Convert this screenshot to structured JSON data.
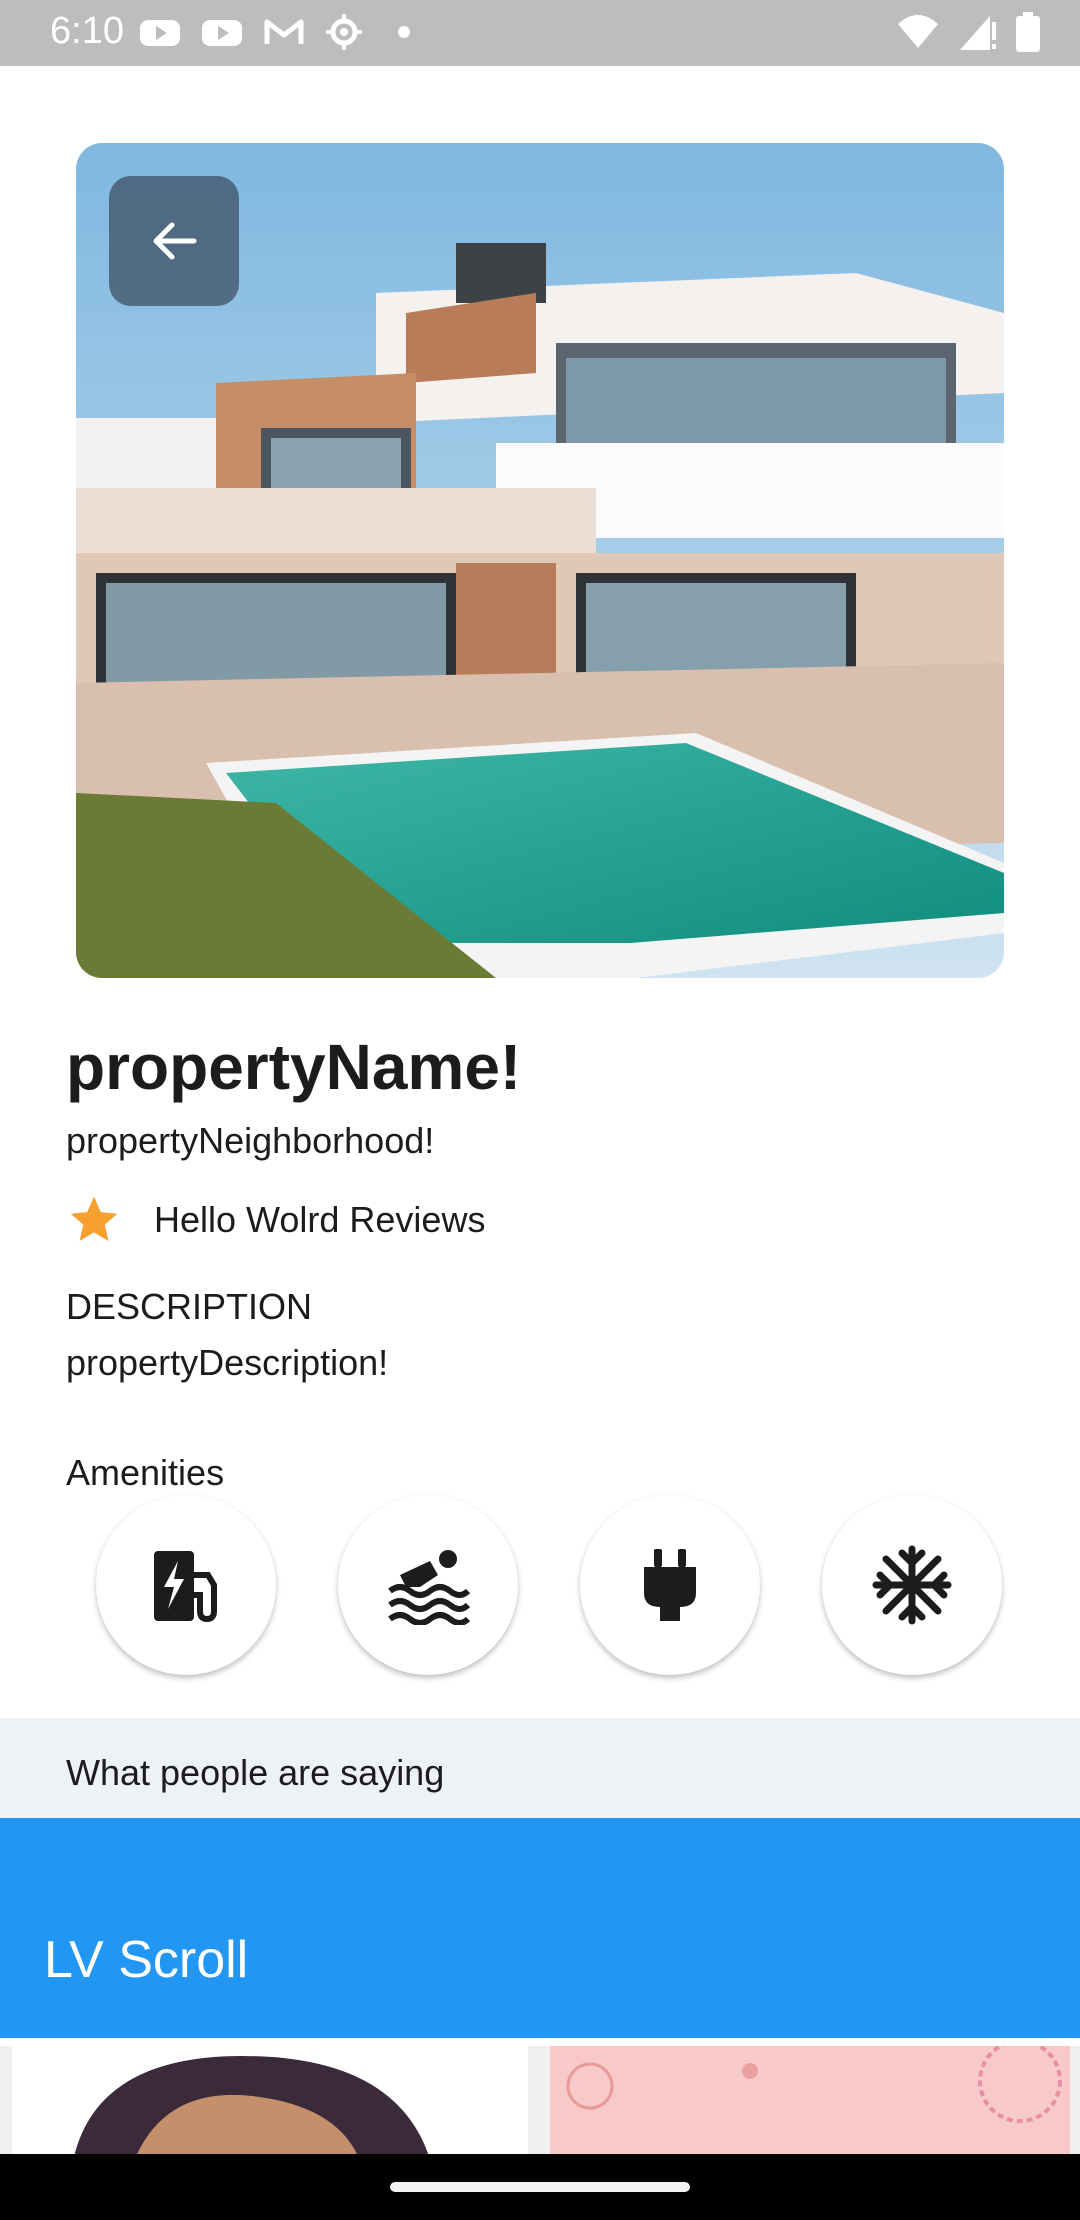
{
  "status_bar": {
    "time": "6:10"
  },
  "property": {
    "name": "propertyName!",
    "neighborhood": "propertyNeighborhood!",
    "rating_text": "Hello Wolrd",
    "reviews_label": "Reviews",
    "description_label": "DESCRIPTION",
    "description": "propertyDescription!",
    "amenities_label": "Amenities"
  },
  "amenities": [
    {
      "icon": "ev-station-icon"
    },
    {
      "icon": "pool-icon"
    },
    {
      "icon": "power-plug-icon"
    },
    {
      "icon": "snowflake-ac-icon"
    }
  ],
  "reviews_section": {
    "title": "What people are saying"
  },
  "appbar": {
    "title": "LV Scroll"
  },
  "colors": {
    "accent": "#2196f3",
    "star": "#f6a02e",
    "section_bg": "#eef1f5"
  }
}
